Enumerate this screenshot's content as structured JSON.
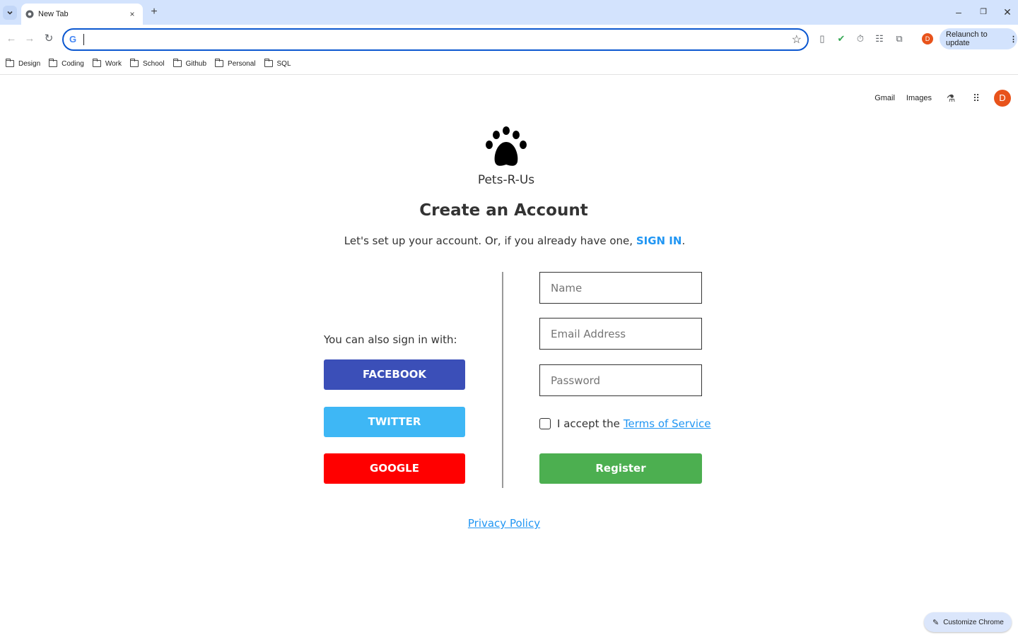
{
  "browser": {
    "tab_title": "New Tab",
    "tab_close": "×",
    "new_tab": "+",
    "window_controls": {
      "minimize": "–",
      "restore": "❐",
      "close": "✕"
    },
    "nav": {
      "back": "←",
      "forward": "→",
      "reload": "↻"
    },
    "omnibox": {
      "value": "",
      "google_letter": "G",
      "star": "☆"
    },
    "extensions": [
      "▯",
      "✔",
      "⏱",
      "☷",
      "⧉"
    ],
    "profile_initial": "D",
    "relaunch_label": "Relaunch to update",
    "relaunch_menu": "⋮",
    "bookmarks": [
      "Design",
      "Coding",
      "Work",
      "School",
      "Github",
      "Personal",
      "SQL"
    ]
  },
  "ntp": {
    "gmail": "Gmail",
    "images": "Images",
    "labs_icon": "⚗",
    "apps_icon": "⠿",
    "avatar_initial": "D",
    "customize_label": "Customize Chrome",
    "customize_icon": "✎"
  },
  "form": {
    "brand": "Pets-R-Us",
    "heading": "Create an Account",
    "subline_prefix": "Let's set up your account. Or, if you already have one, ",
    "signin_link": "SIGN IN",
    "subline_suffix": ".",
    "also_sign_in": "You can also sign in with:",
    "facebook": "FACEBOOK",
    "twitter": "TWITTER",
    "google": "GOOGLE",
    "name_placeholder": "Name",
    "email_placeholder": "Email Address",
    "password_placeholder": "Password",
    "terms_prefix": "I accept the",
    "terms_link": "Terms of Service",
    "register": "Register",
    "privacy": "Privacy Policy"
  },
  "colors": {
    "facebook": "#3b4fb8",
    "twitter": "#3eb7f5",
    "google": "#ff0000",
    "register": "#4caf50",
    "link": "#2196f3",
    "chrome_accent": "#0b57d0"
  }
}
